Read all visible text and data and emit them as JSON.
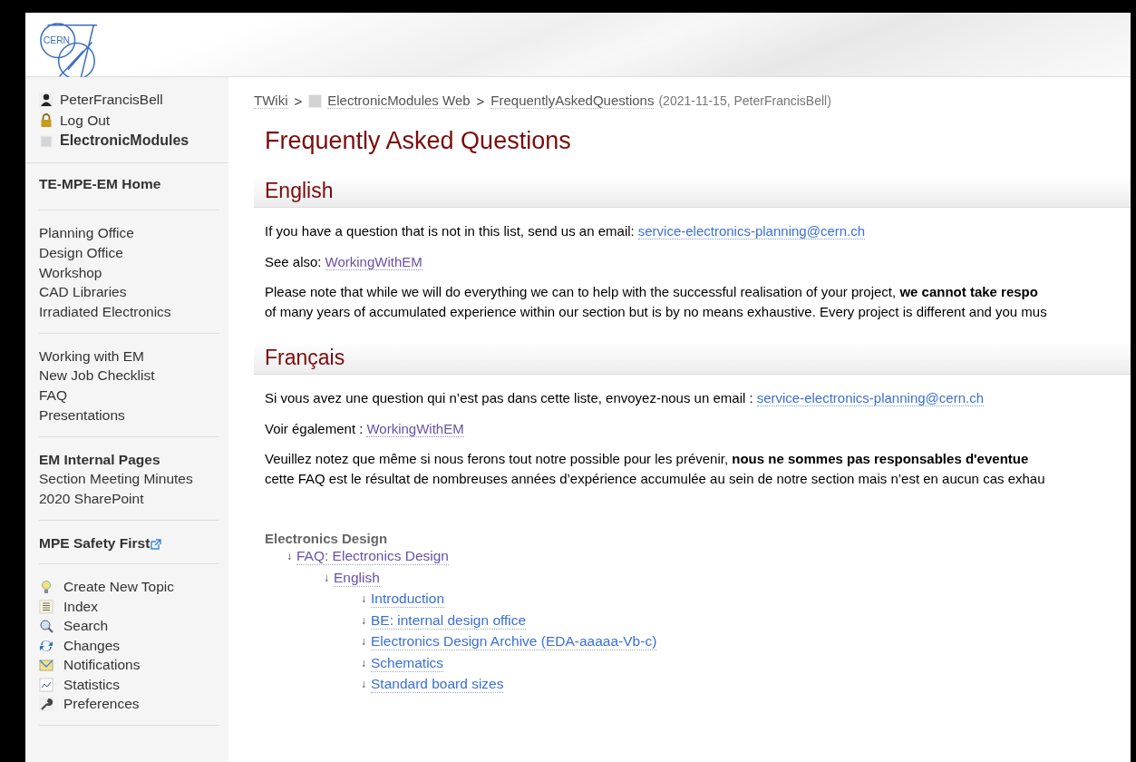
{
  "header": {
    "logo_text": "CERN"
  },
  "sidebar": {
    "sections": [
      {
        "kind": "user",
        "items": [
          {
            "label": "PeterFrancisBell",
            "bold": false
          },
          {
            "label": "Log Out",
            "bold": false
          },
          {
            "label": "ElectronicModules",
            "bold": true
          }
        ]
      },
      {
        "kind": "links",
        "items": [
          {
            "label": "TE-MPE-EM Home",
            "bold": true
          }
        ]
      },
      {
        "kind": "links",
        "items": [
          {
            "label": "Planning Office",
            "bold": false
          },
          {
            "label": "Design Office",
            "bold": false
          },
          {
            "label": "Workshop",
            "bold": false
          },
          {
            "label": "CAD Libraries",
            "bold": false
          },
          {
            "label": "Irradiated Electronics",
            "bold": false
          }
        ]
      },
      {
        "kind": "links",
        "items": [
          {
            "label": "Working with EM",
            "bold": false
          },
          {
            "label": "New Job Checklist",
            "bold": false
          },
          {
            "label": "FAQ",
            "bold": false
          },
          {
            "label": "Presentations",
            "bold": false
          }
        ]
      },
      {
        "kind": "links",
        "items": [
          {
            "label": "EM Internal Pages",
            "bold": true
          },
          {
            "label": "Section Meeting Minutes",
            "bold": false
          },
          {
            "label": "2020 SharePoint",
            "bold": false
          }
        ]
      },
      {
        "kind": "external",
        "items": [
          {
            "label": "MPE Safety First",
            "bold": true
          }
        ]
      },
      {
        "kind": "tools",
        "items": [
          {
            "label": "Create New Topic",
            "bold": false
          },
          {
            "label": "Index",
            "bold": false
          },
          {
            "label": "Search",
            "bold": false
          },
          {
            "label": "Changes",
            "bold": false
          },
          {
            "label": "Notifications",
            "bold": false
          },
          {
            "label": "Statistics",
            "bold": false
          },
          {
            "label": "Preferences",
            "bold": false
          }
        ]
      }
    ]
  },
  "breadcrumb": {
    "separator": ">",
    "items": [
      "TWiki",
      "ElectronicModules Web",
      "FrequentlyAskedQuestions"
    ],
    "meta": "(2021-11-15, PeterFrancisBell)"
  },
  "title": "Frequently Asked Questions",
  "sections": [
    {
      "heading": "English",
      "paragraphs": [
        {
          "kind": "link-line",
          "text": "If you have a question that is not in this list, send us an email:",
          "link": "service-electronics-planning@cern.ch",
          "visited": false
        },
        {
          "kind": "link-line",
          "text": "See also:",
          "link": "WorkingWithEM",
          "visited": true
        },
        {
          "kind": "lines",
          "lines": [
            "Please note that while we will do everything we can to help with the successful realisation of your project, **we cannot take respo**",
            "of many years of accumulated experience within our section but is by no means exhaustive. Every project is different and you mus"
          ]
        }
      ]
    },
    {
      "heading": "Français",
      "paragraphs": [
        {
          "kind": "link-line",
          "text": "Si vous avez une question qui n’est pas dans cette liste, envoyez-nous un email :",
          "link": "service-electronics-planning@cern.ch",
          "visited": false
        },
        {
          "kind": "link-line",
          "text": "Voir également :",
          "link": "WorkingWithEM",
          "visited": true
        },
        {
          "kind": "lines",
          "lines": [
            "Veuillez notez que même si nous ferons tout notre possible pour les prévenir, **nous ne sommes pas responsables d'eventue**",
            "cette FAQ est le résultat de nombreuses années d’expérience accumulée au sein de notre section mais n’est en aucun cas exhau"
          ]
        }
      ]
    }
  ],
  "toc": {
    "heading": "Electronics Design",
    "arrow": "↓",
    "items": [
      {
        "label": "FAQ: Electronics Design",
        "visited": true,
        "children": [
          {
            "label": "English",
            "visited": true,
            "children": [
              {
                "label": "Introduction",
                "visited": false
              },
              {
                "label": "BE: internal design office",
                "visited": false
              },
              {
                "label": "Electronics Design Archive (EDA-aaaaa-Vb-c)",
                "visited": false
              },
              {
                "label": "Schematics",
                "visited": false
              },
              {
                "label": "Standard board sizes",
                "visited": false
              }
            ]
          }
        ]
      }
    ]
  }
}
